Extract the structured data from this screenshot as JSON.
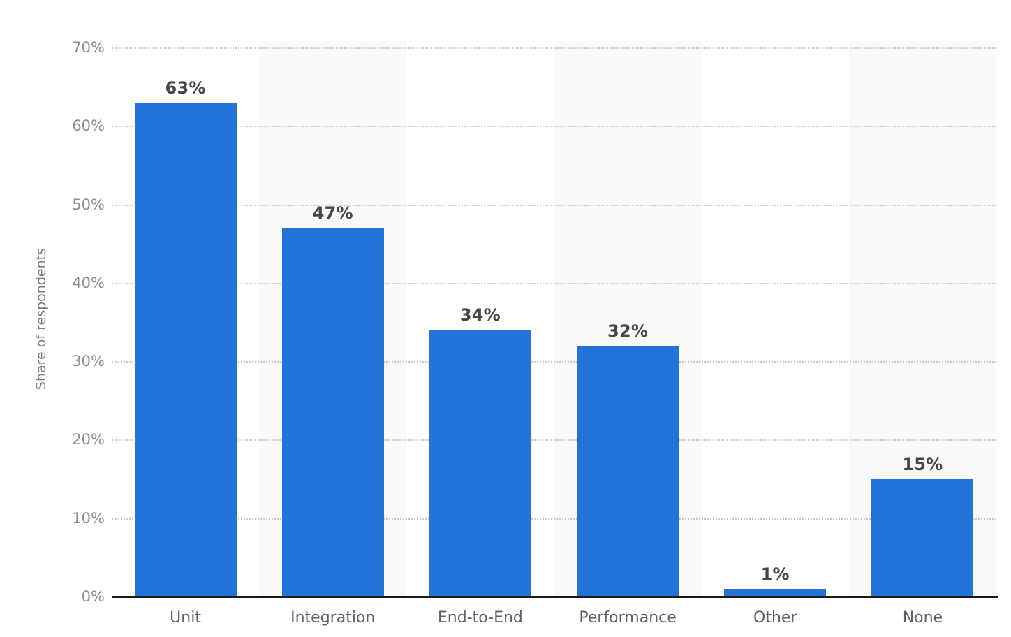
{
  "chart_data": {
    "type": "bar",
    "title": "",
    "subtitle": "",
    "xlabel": "",
    "ylabel": "Share of respondents",
    "categories": [
      "Unit",
      "Integration",
      "End-to-End",
      "Performance",
      "Other",
      "None"
    ],
    "values": [
      63,
      47,
      34,
      32,
      1,
      15
    ],
    "value_labels": [
      "63%",
      "47%",
      "34%",
      "32%",
      "1%",
      "15%"
    ],
    "ylim": [
      0,
      70
    ],
    "ytick_values": [
      0,
      10,
      20,
      30,
      40,
      50,
      60,
      70
    ],
    "ytick_labels": [
      "0%",
      "10%",
      "20%",
      "30%",
      "40%",
      "50%",
      "60%",
      "70%"
    ],
    "grid": "horizontal-dotted",
    "legend": "none",
    "series": [
      {
        "name": "Share of respondents",
        "values": [
          63,
          47,
          34,
          32,
          1,
          15
        ]
      }
    ],
    "colors": {
      "bar": "#2374d8",
      "gridline": "#c9c9c9",
      "baseline": "#1a1a1a",
      "band": "#f9f9f9",
      "background": "#ffffff",
      "value_label": "#464646",
      "tick_label": "#8c8c8c",
      "axis_title": "#7d7d7d",
      "category_label": "#616161"
    }
  }
}
